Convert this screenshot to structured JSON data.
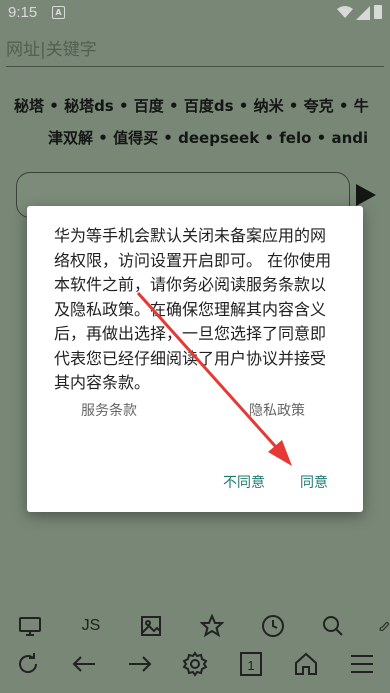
{
  "status_bar": {
    "time": "9:15",
    "app_icon_letter": "A"
  },
  "url_bar": {
    "placeholder": "网址|关键字",
    "value": ""
  },
  "quick_links": {
    "row1": [
      "秘塔",
      "秘塔ds",
      "百度",
      "百度ds",
      "纳米",
      "夸克",
      "牛"
    ],
    "row2": [
      "津双解",
      "值得买",
      "deepseek",
      "felo",
      "andi"
    ],
    "separator": " • "
  },
  "dialog": {
    "message": "华为等手机会默认关闭未备案应用的网络权限，访问设置开启即可。 在你使用本软件之前，请你务必阅读服务条款以及隐私政策。在确保您理解其内容含义后，再做出选择，一旦您选择了同意即代表您已经仔细阅读了用户协议并接受其内容条款。",
    "terms_link": "服务条款",
    "privacy_link": "隐私政策",
    "disagree_button": "不同意",
    "agree_button": "同意"
  },
  "toolbar": {
    "js_label": "JS",
    "tabs_count": "1",
    "icons_row1": [
      "screen-icon",
      "js-icon",
      "image-icon",
      "star-icon",
      "history-icon",
      "search-icon",
      "brush-icon"
    ],
    "icons_row2": [
      "refresh-icon",
      "back-icon",
      "forward-icon",
      "settings-icon",
      "tabs-icon",
      "home-icon",
      "menu-icon"
    ]
  },
  "colors": {
    "background": "#8a9a88",
    "accent": "#1f7a72",
    "arrow": "#e53935"
  }
}
